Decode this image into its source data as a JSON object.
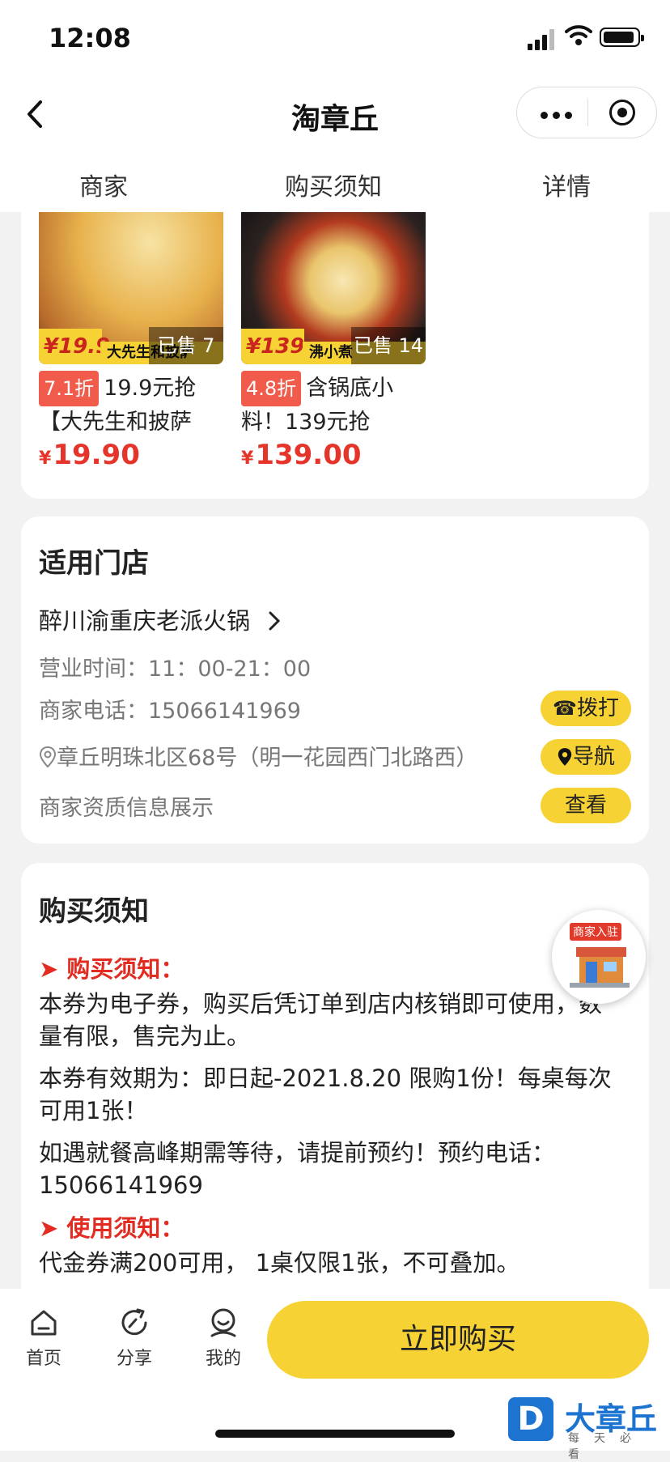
{
  "status": {
    "time": "12:08"
  },
  "nav": {
    "title": "淘章丘"
  },
  "tabs": [
    "商家",
    "购买须知",
    "详情"
  ],
  "products": [
    {
      "price_tag": "¥19.9",
      "banner": "大先生和披萨",
      "sold": "已售 7",
      "discount": "7.1折",
      "title": "19.9元抢【大先生和披萨店…",
      "currency": "¥",
      "price": "19.90"
    },
    {
      "price_tag": "¥139",
      "banner": "沸小煮",
      "sold": "已售 14",
      "discount": "4.8折",
      "title": "含锅底小料！139元抢【沸…",
      "currency": "¥",
      "price": "139.00"
    }
  ],
  "store": {
    "section_title": "适用门店",
    "name": "醉川渝重庆老派火锅",
    "hours": "营业时间：11：00-21：00",
    "phone": "商家电话：15066141969",
    "address": "章丘明珠北区68号（明一花园西门北路西）",
    "qualification": "商家资质信息展示",
    "call_label": "拨打",
    "nav_label": "导航",
    "view_label": "查看"
  },
  "notice": {
    "section_title": "购买须知",
    "h1": "购买须知：",
    "p1": "本券为电子券，购买后凭订单到店内核销即可使用，数量有限，售完为止。",
    "p2": "本券有效期为：即日起-2021.8.20  限购1份！每桌每次可用1张！",
    "p3": "如遇就餐高峰期需等待，请提前预约！预约电话：15066141969",
    "h2": "使用须知：",
    "p4": "代金券满200可用，  1桌仅限1张，不可叠加。"
  },
  "merchant_float": {
    "label": "商家入驻"
  },
  "bottom": {
    "home": "首页",
    "share": "分享",
    "mine": "我的",
    "buy": "立即购买"
  },
  "watermark": {
    "logo": "D",
    "name": "大章丘",
    "sub": "每天必看"
  },
  "colors": {
    "accent": "#f7d234",
    "price_red": "#e5352b",
    "discount_bg": "#f05b4b",
    "brand_blue": "#1d74d0"
  }
}
